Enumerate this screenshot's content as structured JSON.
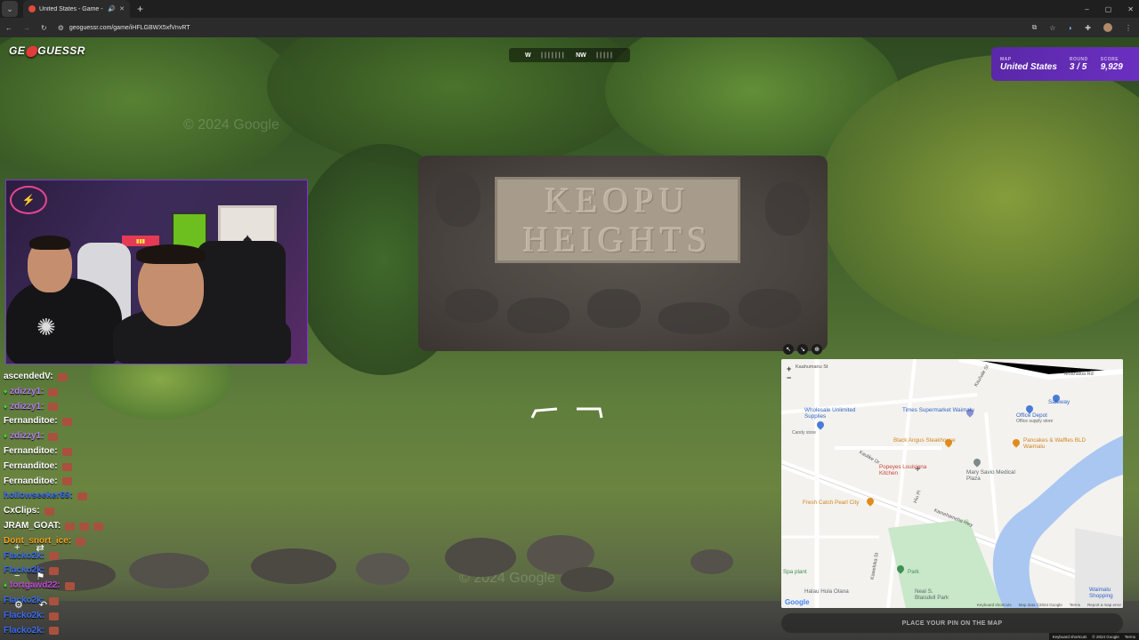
{
  "browser": {
    "tab_title": "United States - Game - Ge...",
    "url": "geoguessr.com/game/iHFLGBWX5xfVnvRT",
    "new_tab_label": "+",
    "minimize": "–",
    "maximize": "▢",
    "close": "✕"
  },
  "game": {
    "logo_text_a": "GE",
    "logo_pin": "⬤",
    "logo_text_b": "GUESSR",
    "compass_w": "W",
    "compass_nw": "NW",
    "status": {
      "map_label": "MAP",
      "map_value": "United States",
      "round_label": "ROUND",
      "round_value": "3 / 5",
      "score_label": "SCORE",
      "score_value": "9,929"
    },
    "sign_line1": "KEOPU",
    "sign_line2": "HEIGHTS",
    "watermark": "© 2024 Google",
    "place_pin_label": "PLACE YOUR PIN ON THE MAP",
    "page_footer": [
      "Keyboard shortcuts",
      "© 2024 Google",
      "Terms"
    ]
  },
  "chat": [
    {
      "user": "ascendedV:",
      "color": "#ffffff",
      "badge": false,
      "emotes": 1
    },
    {
      "user": "zdizzy1:",
      "color": "#b87df5",
      "badge": true,
      "emotes": 1
    },
    {
      "user": "zdizzy1:",
      "color": "#b87df5",
      "badge": true,
      "emotes": 1
    },
    {
      "user": "Fernanditoe:",
      "color": "#ffffff",
      "badge": false,
      "emotes": 1
    },
    {
      "user": "zdizzy1:",
      "color": "#b87df5",
      "badge": true,
      "emotes": 1
    },
    {
      "user": "Fernanditoe:",
      "color": "#ffffff",
      "badge": false,
      "emotes": 1
    },
    {
      "user": "Fernanditoe:",
      "color": "#ffffff",
      "badge": false,
      "emotes": 1
    },
    {
      "user": "Fernanditoe:",
      "color": "#ffffff",
      "badge": false,
      "emotes": 1
    },
    {
      "user": "hollowseeker69:",
      "color": "#3a6cf0",
      "badge": false,
      "emotes": 1
    },
    {
      "user": "CxClips:",
      "color": "#ffffff",
      "badge": false,
      "emotes": 1
    },
    {
      "user": "JRAM_GOAT:",
      "color": "#ffffff",
      "badge": false,
      "emotes": 3
    },
    {
      "user": "Dont_snort_ice:",
      "color": "#f2a21c",
      "badge": false,
      "emotes": 1
    },
    {
      "user": "Flacko2k:",
      "color": "#3a6cf0",
      "badge": false,
      "emotes": 1
    },
    {
      "user": "Flacko2k:",
      "color": "#3a6cf0",
      "badge": false,
      "emotes": 1
    },
    {
      "user": "fortgawd22:",
      "color": "#c04ad9",
      "badge": true,
      "emotes": 1
    },
    {
      "user": "Flacko2k:",
      "color": "#3a6cf0",
      "badge": false,
      "emotes": 1
    },
    {
      "user": "Flacko2k:",
      "color": "#3a6cf0",
      "badge": false,
      "emotes": 1
    },
    {
      "user": "Flacko2k:",
      "color": "#3a6cf0",
      "badge": false,
      "emotes": 1
    }
  ],
  "map": {
    "zoom_in": "+",
    "zoom_out": "−",
    "crosshair": "+",
    "google": "Google",
    "footer": [
      "Keyboard shortcuts",
      "Map data ©2024 Google",
      "Terms",
      "Report a map error"
    ],
    "roads": [
      "Moanalua Rd",
      "Kaahumanu St",
      "Kauhale St",
      "Kaulike Dr",
      "Hiu Pl",
      "Kamehameha Hwy",
      "Kaahumanu St",
      "Kaweloka St",
      "Kamehameha Hwy",
      "Moanalua Rd"
    ],
    "pois": [
      {
        "name": "Safeway",
        "color": "blue"
      },
      {
        "name": "Office Depot",
        "color": "blue"
      },
      {
        "name": "Office supply store",
        "color": "gray"
      },
      {
        "name": "Times Supermarket Waimalu",
        "color": "blue"
      },
      {
        "name": "Wholesale Unlimited Supplies",
        "color": "blue"
      },
      {
        "name": "Candy store",
        "color": "gray"
      },
      {
        "name": "Black Angus Steakhouse",
        "color": "orange"
      },
      {
        "name": "Pancakes & Waffles BLD Waimalu",
        "color": "orange"
      },
      {
        "name": "Popeyes Louisiana Kitchen",
        "color": "red"
      },
      {
        "name": "Mary Savio Medical Plaza",
        "color": "gray"
      },
      {
        "name": "Fresh Catch Pearl City",
        "color": "orange"
      },
      {
        "name": "Park",
        "color": "green"
      },
      {
        "name": "Halau Hula Olana",
        "color": "gray"
      },
      {
        "name": "Neal S. Blaisdell Park",
        "color": "gray"
      },
      {
        "name": "Waimalu Shopping",
        "color": "blue"
      },
      {
        "name": "Spa plant",
        "color": "green"
      }
    ]
  }
}
